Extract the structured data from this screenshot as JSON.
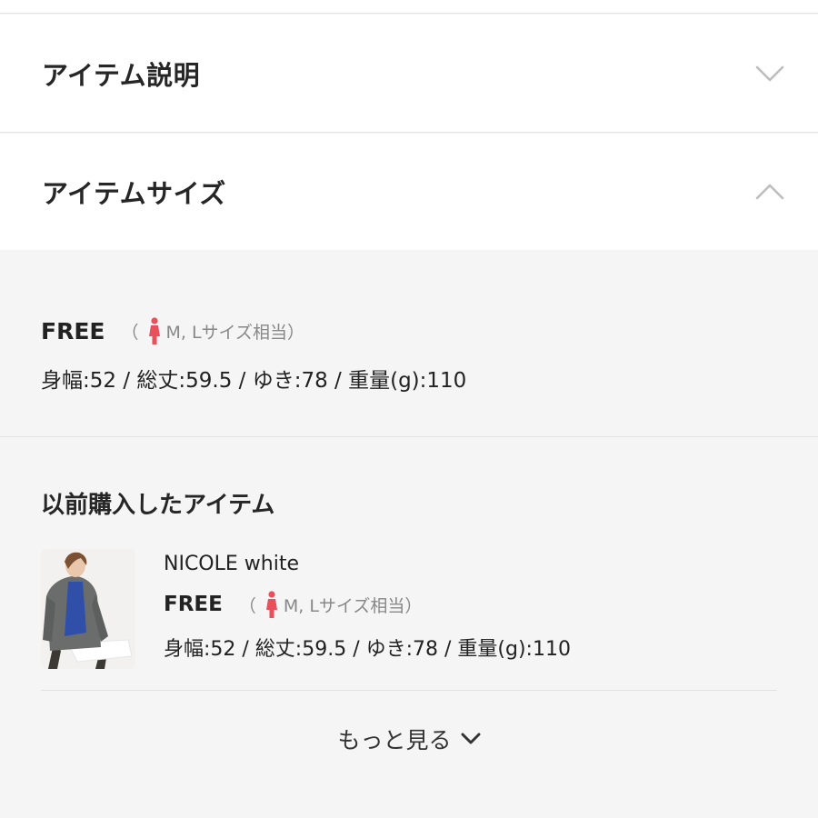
{
  "accordion": {
    "item_description": {
      "title": "アイテム説明",
      "icon": "chevron-down-icon"
    },
    "item_size": {
      "title": "アイテムサイズ",
      "icon": "chevron-up-icon"
    }
  },
  "size": {
    "label": "FREE",
    "note_open": "（",
    "note_text": "M, Lサイズ相当）",
    "dims": "身幅:52 / 総丈:59.5 / ゆき:78 / 重量(g):110"
  },
  "previous": {
    "title": "以前購入したアイテム",
    "item": {
      "name": "NICOLE white",
      "size_label": "FREE",
      "note_open": "（",
      "note_text": "M, Lサイズ相当）",
      "dims": "身幅:52 / 総丈:59.5 / ゆき:78 / 重量(g):110"
    }
  },
  "more": {
    "label": "もっと見る",
    "icon": "chevron-down-icon"
  },
  "colors": {
    "accent_person": "#e8505b",
    "chevron": "#bdbdbd",
    "background": "#f5f5f5"
  }
}
